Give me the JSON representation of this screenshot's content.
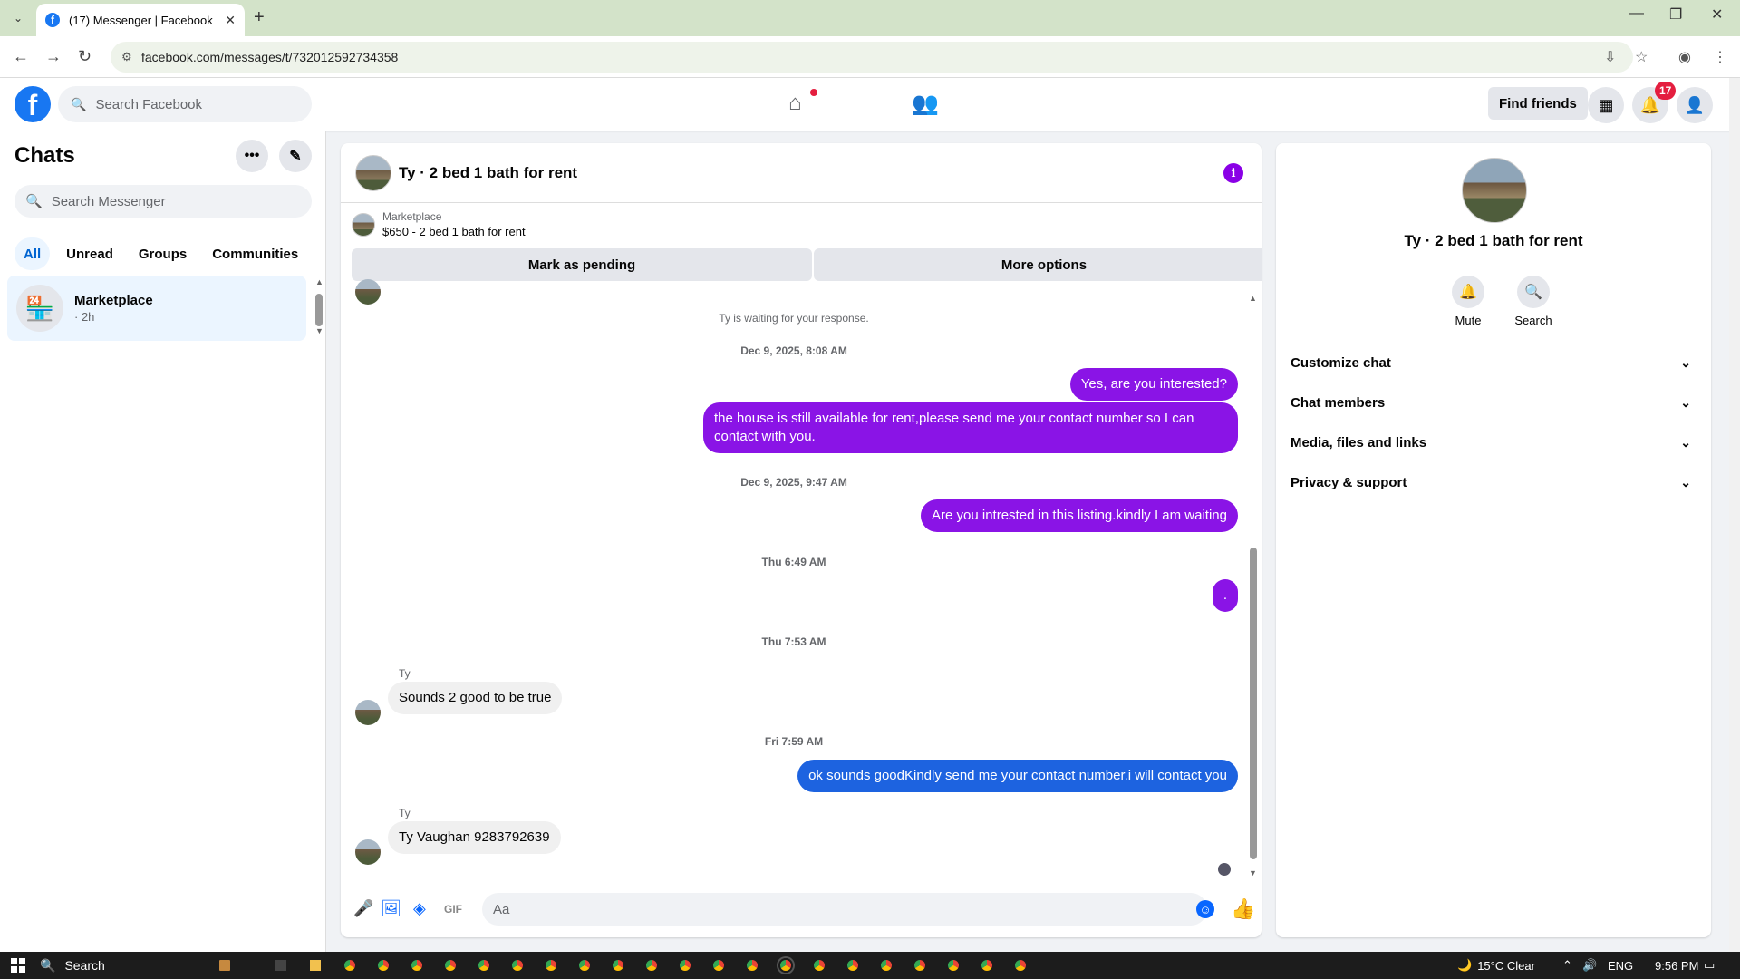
{
  "browser": {
    "tab_title": "(17) Messenger | Facebook",
    "url": "facebook.com/messages/t/732012592734358"
  },
  "header": {
    "logo_letter": "f",
    "search_placeholder": "Search Facebook",
    "find_friends": "Find friends",
    "notification_count": "17"
  },
  "sidebar": {
    "title": "Chats",
    "search_placeholder": "Search Messenger",
    "filters": [
      "All",
      "Unread",
      "Groups",
      "Communities"
    ],
    "active_filter": "All",
    "chats": [
      {
        "name": "Marketplace",
        "time": "· 2h"
      }
    ]
  },
  "conversation": {
    "title": "Ty · 2 bed 1 bath for rent",
    "marketplace_label": "Marketplace",
    "listing": "$650 - 2 bed 1 bath for rent",
    "mark_pending": "Mark as pending",
    "more_options": "More options",
    "system_message": "Ty is waiting for your response.",
    "messages": [
      {
        "type": "timestamp",
        "text": "Dec 9, 2025, 8:08 AM"
      },
      {
        "type": "out",
        "text": "Yes, are you interested?"
      },
      {
        "type": "out",
        "text": "the house is still available for rent,please send me your contact number so I can contact with you."
      },
      {
        "type": "timestamp",
        "text": "Dec 9, 2025, 9:47 AM"
      },
      {
        "type": "out",
        "text": "Are you intrested in this listing.kindly I am waiting"
      },
      {
        "type": "timestamp",
        "text": "Thu 6:49 AM"
      },
      {
        "type": "out",
        "text": "."
      },
      {
        "type": "timestamp",
        "text": "Thu 7:53 AM"
      },
      {
        "type": "in",
        "sender": "Ty",
        "text": "Sounds 2 good to be true"
      },
      {
        "type": "timestamp",
        "text": "Fri 7:59 AM"
      },
      {
        "type": "out",
        "text": "ok sounds goodKindly send me your contact number.i will contact you"
      },
      {
        "type": "in",
        "sender": "Ty",
        "text": "Ty Vaughan 9283792639"
      }
    ],
    "composer_placeholder": "Aa"
  },
  "details": {
    "title": "Ty · 2 bed 1 bath for rent",
    "actions": [
      "Mute",
      "Search"
    ],
    "sections": [
      "Customize chat",
      "Chat members",
      "Media, files and links",
      "Privacy & support"
    ]
  },
  "taskbar": {
    "search_label": "Search",
    "weather": "15°C  Clear",
    "language": "ENG",
    "time": "9:56 PM"
  },
  "colors": {
    "brand": "#1877f2",
    "outgoing_purple": "#8a14e6",
    "outgoing_blue": "#1d63e0",
    "notification_red": "#e41e3f"
  }
}
